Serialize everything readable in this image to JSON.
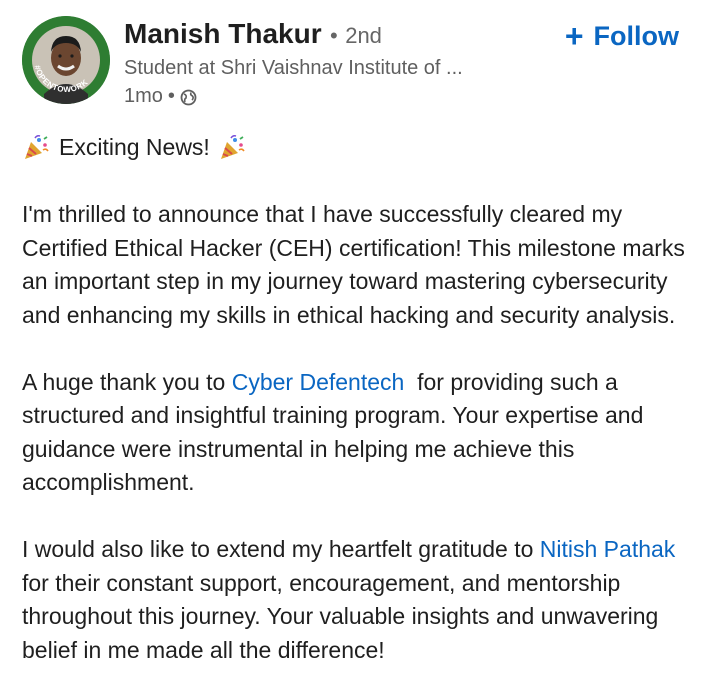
{
  "author": {
    "name": "Manish Thakur",
    "degree_separator": "•",
    "degree": "2nd",
    "headline": "Student at Shri Vaishnav Institute of ...",
    "time": "1mo",
    "time_separator": "•",
    "visibility_icon": "globe-icon",
    "avatar_badge": "#OPENTOWORK"
  },
  "follow_button": {
    "plus": "+",
    "label": "Follow"
  },
  "post": {
    "p1": {
      "icon_left": "party-popper-icon",
      "text": "Exciting News!",
      "icon_right": "party-popper-icon"
    },
    "p2": "I'm thrilled to announce that I have successfully cleared my Certified Ethical Hacker (CEH) certification! This milestone marks an important step in my journey toward mastering cybersecurity and enhancing my skills in ethical hacking and security analysis.",
    "p3": {
      "before": "A huge thank you to ",
      "mention": "Cyber Defentech",
      "after": "  for providing such a structured and insightful training program. Your expertise and guidance were instrumental in helping me achieve this accomplishment."
    },
    "p4": {
      "before": "I would also like to extend my heartfelt gratitude to ",
      "mention": "Nitish Pathak",
      "after": "  for their constant support, encouragement, and mentorship throughout this journey. Your valuable insights and unwavering belief in me made all the difference!"
    }
  },
  "colors": {
    "link": "#0a66c2",
    "text": "#1f1f1f",
    "muted": "#5f5f5f",
    "open_to_work": "#2e7d32"
  }
}
